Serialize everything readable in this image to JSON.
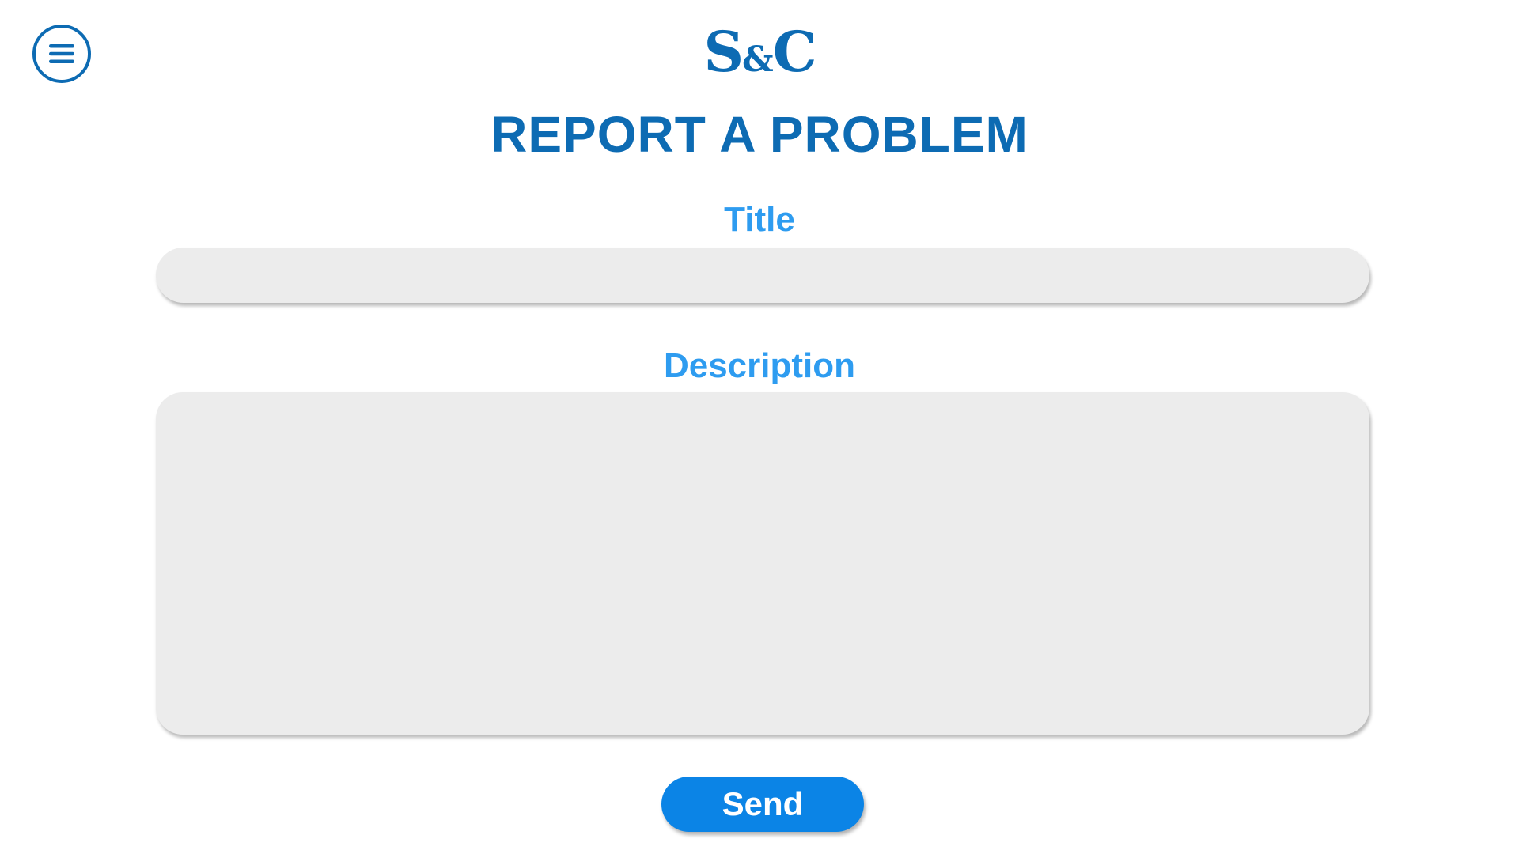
{
  "header": {
    "menu_icon": "hamburger-menu-icon",
    "logo": {
      "left": "S",
      "amp": "&",
      "right": "C"
    },
    "title": "REPORT A PROBLEM"
  },
  "form": {
    "title_label": "Title",
    "title_value": "",
    "title_placeholder": "",
    "description_label": "Description",
    "description_value": "",
    "description_placeholder": "",
    "send_label": "Send"
  },
  "colors": {
    "brand_dark_blue": "#0d6bb3",
    "label_light_blue": "#2e9cf0",
    "button_blue": "#0b84e6",
    "input_background": "#ececec"
  }
}
